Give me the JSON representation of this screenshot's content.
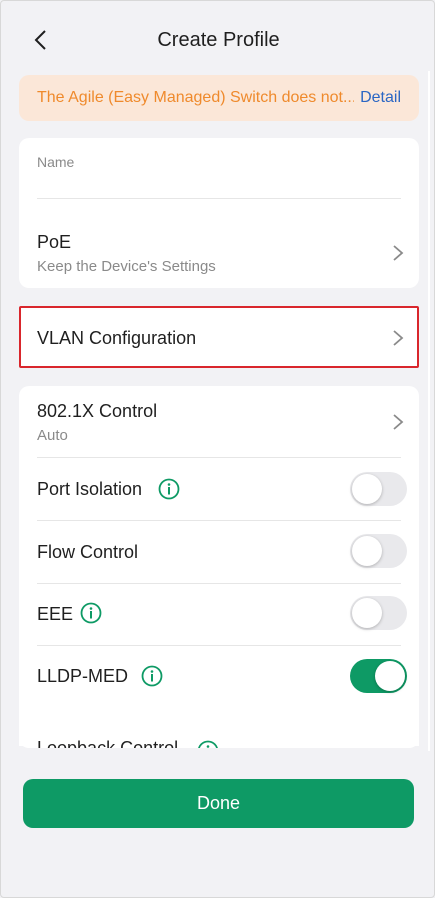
{
  "header": {
    "title": "Create Profile"
  },
  "banner": {
    "text": "The Agile (Easy Managed) Switch does not...",
    "link": "Detail"
  },
  "name_field": {
    "label": "Name",
    "value": ""
  },
  "poe": {
    "title": "PoE",
    "value": "Keep the Device's Settings"
  },
  "vlan": {
    "title": "VLAN Configuration"
  },
  "dot1x": {
    "title": "802.1X Control",
    "value": "Auto"
  },
  "port_isolation": {
    "title": "Port Isolation",
    "enabled": false
  },
  "flow_control": {
    "title": "Flow Control",
    "enabled": false
  },
  "eee": {
    "title": "EEE",
    "enabled": false
  },
  "lldp_med": {
    "title": "LLDP-MED",
    "enabled": true
  },
  "loopback": {
    "title": "Loopback Control"
  },
  "footer": {
    "done_label": "Done"
  },
  "colors": {
    "accent": "#0e9a65",
    "warning_bg": "#fbe7d8",
    "warning_text": "#ef8a2c",
    "link": "#2a66c4",
    "highlight": "#d9262c"
  }
}
